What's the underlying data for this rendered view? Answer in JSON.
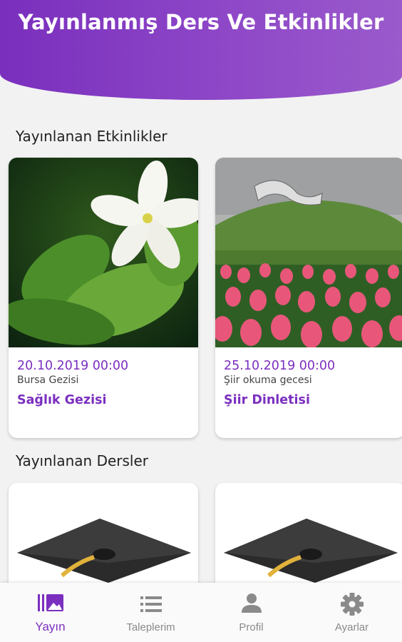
{
  "header": {
    "title": "Yayınlanmış Ders Ve Etkinlikler"
  },
  "events_section": {
    "title": "Yayınlanan Etkinlikler",
    "cards": [
      {
        "date": "20.10.2019 00:00",
        "subtitle": "Bursa Gezisi",
        "title": "Sağlık Gezisi",
        "image": "white-jasmine-flower"
      },
      {
        "date": "25.10.2019 00:00",
        "subtitle": "Şiir okuma gecesi",
        "title": "Şiir Dinletisi",
        "image": "pink-tulip-field"
      }
    ]
  },
  "lessons_section": {
    "title": "Yayınlanan Dersler",
    "cards": [
      {
        "image": "graduation-cap"
      },
      {
        "image": "graduation-cap"
      }
    ]
  },
  "bottom_nav": {
    "items": [
      {
        "label": "Yayın",
        "icon": "gallery-icon",
        "active": true
      },
      {
        "label": "Taleplerim",
        "icon": "list-icon",
        "active": false
      },
      {
        "label": "Profil",
        "icon": "person-icon",
        "active": false
      },
      {
        "label": "Ayarlar",
        "icon": "gear-icon",
        "active": false
      }
    ]
  },
  "colors": {
    "accent": "#7b2fbf",
    "header_start": "#7a2fbd",
    "header_end": "#9a5acb",
    "background": "#f2f2f2"
  }
}
